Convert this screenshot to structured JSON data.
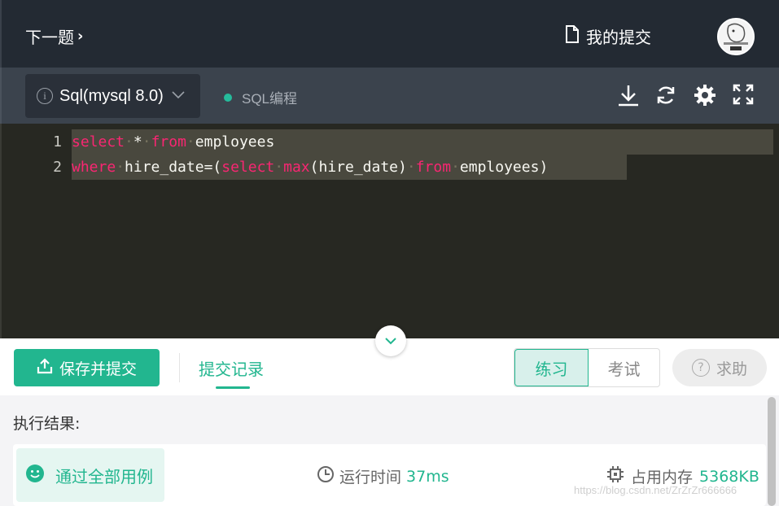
{
  "header": {
    "next_question": "下一题",
    "my_submissions": "我的提交"
  },
  "toolbar": {
    "language": "Sql(mysql 8.0)",
    "mode_label": "SQL编程"
  },
  "editor": {
    "lines": [
      {
        "num": "1"
      },
      {
        "num": "2"
      }
    ]
  },
  "actions": {
    "save_submit": "保存并提交",
    "submit_history": "提交记录",
    "practice": "练习",
    "exam": "考试",
    "help": "求助"
  },
  "result": {
    "title": "执行结果:",
    "status": "通过全部用例",
    "runtime_label": "运行时间",
    "runtime_value": "37ms",
    "memory_label": "占用内存",
    "memory_value": "5368KB"
  },
  "watermark": "https://blog.csdn.net/ZrZrZr666666",
  "colors": {
    "accent": "#22b68f",
    "header_bg": "#232a33",
    "toolbar_bg": "#3b434d",
    "editor_bg": "#272822",
    "keyword": "#f92672"
  }
}
